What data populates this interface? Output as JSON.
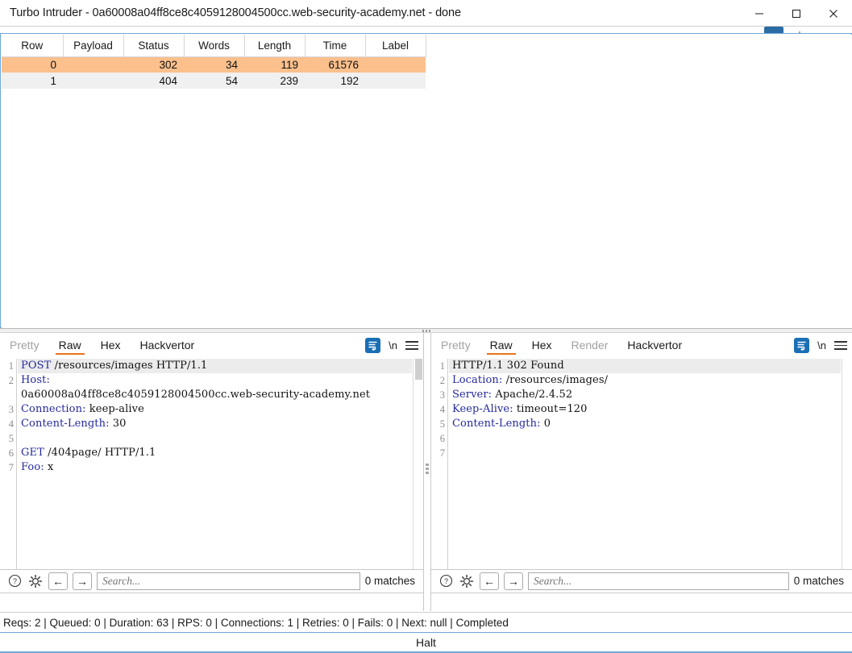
{
  "window": {
    "title": "Turbo Intruder - 0a60008a04ff8ce8c4059128004500cc.web-security-academy.net - done",
    "minimize_label": "Minimize",
    "maximize_label": "Maximize",
    "close_label": "Close"
  },
  "results_table": {
    "columns": [
      "Row",
      "Payload",
      "Status",
      "Words",
      "Length",
      "Time",
      "Label"
    ],
    "rows": [
      {
        "row": "0",
        "payload": "",
        "status": "302",
        "words": "34",
        "length": "119",
        "time": "61576",
        "label": "",
        "selected": true
      },
      {
        "row": "1",
        "payload": "",
        "status": "404",
        "words": "54",
        "length": "239",
        "time": "192",
        "label": "",
        "selected": false
      }
    ],
    "selected_color": "#fbc08c",
    "alt_row_color": "#f0f0f0"
  },
  "request_pane": {
    "tabs": [
      {
        "label": "Pretty",
        "state": "disabled"
      },
      {
        "label": "Raw",
        "state": "active"
      },
      {
        "label": "Hex",
        "state": "normal"
      },
      {
        "label": "Hackvertor",
        "state": "normal"
      }
    ],
    "actions": {
      "wrap_icon": "word-wrap-icon",
      "newline_label": "\\n",
      "menu_icon": "hamburger-menu-icon"
    },
    "line_numbers": [
      "1",
      "2",
      "",
      "3",
      "4",
      "5",
      "6",
      "7"
    ],
    "lines": [
      {
        "num": "1",
        "kw": "POST",
        "rest": " /resources/images HTTP/1.1",
        "highlight": true
      },
      {
        "num": "2",
        "kw": "Host:",
        "rest": "",
        "highlight": false
      },
      {
        "num": "",
        "kw": "",
        "rest": "0a60008a04ff8ce8c4059128004500cc.web-security-academy.net",
        "highlight": false
      },
      {
        "num": "3",
        "kw": "Connection:",
        "rest": " keep-alive",
        "highlight": false
      },
      {
        "num": "4",
        "kw": "Content-Length:",
        "rest": " 30",
        "highlight": false
      },
      {
        "num": "5",
        "kw": "",
        "rest": "",
        "highlight": false
      },
      {
        "num": "6",
        "kw": "GET",
        "rest": " /404page/ HTTP/1.1",
        "highlight": false
      },
      {
        "num": "7",
        "kw": "Foo:",
        "rest": " x",
        "highlight": false
      }
    ],
    "search": {
      "placeholder": "Search...",
      "value": "",
      "matches": "0 matches",
      "help_icon": "help-circle-icon",
      "settings_icon": "gear-icon",
      "prev_label": "←",
      "next_label": "→"
    }
  },
  "response_pane": {
    "tabs": [
      {
        "label": "Pretty",
        "state": "disabled"
      },
      {
        "label": "Raw",
        "state": "active"
      },
      {
        "label": "Hex",
        "state": "normal"
      },
      {
        "label": "Render",
        "state": "disabled"
      },
      {
        "label": "Hackvertor",
        "state": "normal"
      }
    ],
    "actions": {
      "wrap_icon": "word-wrap-icon",
      "newline_label": "\\n",
      "menu_icon": "hamburger-menu-icon"
    },
    "lines": [
      {
        "num": "1",
        "kw": "",
        "rest": "HTTP/1.1 302 Found",
        "highlight": true
      },
      {
        "num": "2",
        "kw": "Location:",
        "rest": " /resources/images/",
        "highlight": false
      },
      {
        "num": "3",
        "kw": "Server:",
        "rest": " Apache/2.4.52",
        "highlight": false
      },
      {
        "num": "4",
        "kw": "Keep-Alive:",
        "rest": " timeout=120",
        "highlight": false
      },
      {
        "num": "5",
        "kw": "Content-Length:",
        "rest": " 0",
        "highlight": false
      },
      {
        "num": "6",
        "kw": "",
        "rest": "",
        "highlight": false
      },
      {
        "num": "7",
        "kw": "",
        "rest": "",
        "highlight": false
      }
    ],
    "search": {
      "placeholder": "Search...",
      "value": "",
      "matches": "0 matches",
      "help_icon": "help-circle-icon",
      "settings_icon": "gear-icon",
      "prev_label": "←",
      "next_label": "→"
    }
  },
  "status_bar": {
    "text": "Reqs: 2 | Queued: 0 | Duration: 63 | RPS: 0 | Connections: 1 | Retries: 0 | Fails: 0 | Next: null | Completed"
  },
  "halt_button": {
    "label": "Halt"
  },
  "theme": {
    "accent_orange": "#e8731a",
    "frame_blue": "#6fa8dc",
    "keyword_blue": "#25299e",
    "wrap_icon_blue": "#1a6fb5"
  }
}
